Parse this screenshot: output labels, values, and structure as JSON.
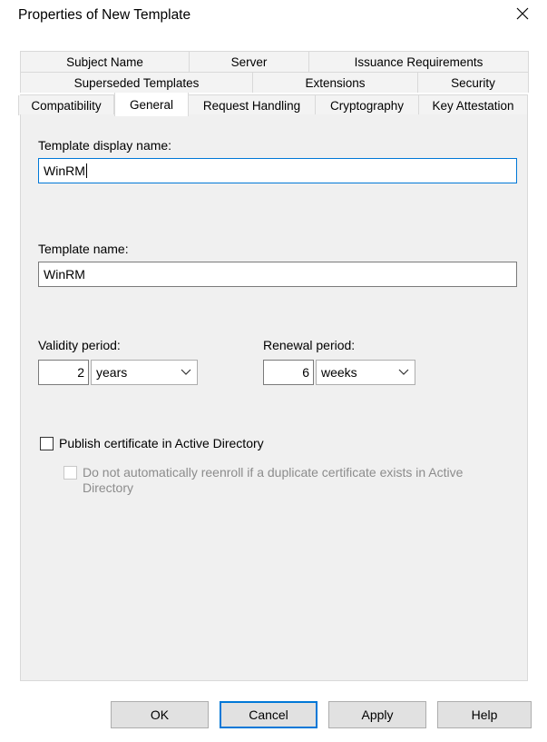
{
  "window": {
    "title": "Properties of New Template"
  },
  "tabs": {
    "row1": [
      "Subject Name",
      "Server",
      "Issuance Requirements"
    ],
    "row2": [
      "Superseded Templates",
      "Extensions",
      "Security"
    ],
    "row3": [
      "Compatibility",
      "General",
      "Request Handling",
      "Cryptography",
      "Key Attestation"
    ],
    "active": "General"
  },
  "general": {
    "display_name_label": "Template display name:",
    "display_name_value": "WinRM",
    "template_name_label": "Template name:",
    "template_name_value": "WinRM",
    "validity_label": "Validity period:",
    "validity_number": "2",
    "validity_unit": "years",
    "renewal_label": "Renewal period:",
    "renewal_number": "6",
    "renewal_unit": "weeks",
    "publish_label": "Publish certificate in Active Directory",
    "publish_checked": false,
    "reenroll_label": "Do not automatically reenroll if a duplicate certificate exists in Active Directory",
    "reenroll_checked": false
  },
  "buttons": {
    "ok": "OK",
    "cancel": "Cancel",
    "apply": "Apply",
    "help": "Help"
  },
  "colors": {
    "accent": "#0078d7",
    "panel": "#f0f0f0",
    "button": "#e1e1e1"
  }
}
